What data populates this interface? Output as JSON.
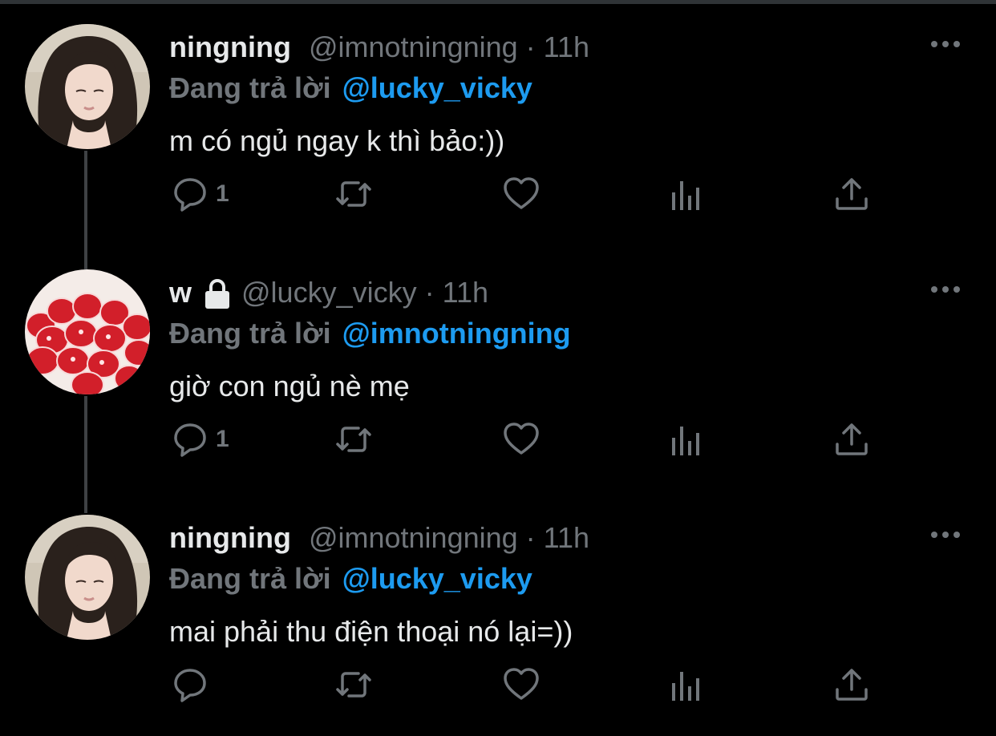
{
  "tweets": [
    {
      "display_name": "ningning",
      "handle": "@imnotningning",
      "separator": "·",
      "time": "11h",
      "reply_prefix": "Đang trả lời",
      "reply_to": "@lucky_vicky",
      "text": "m có ngủ ngay k thì bảo:))",
      "reply_count": "1",
      "locked": false,
      "avatar_icon": "profile-photo-woman"
    },
    {
      "display_name": "w",
      "handle": "@lucky_vicky",
      "separator": "·",
      "time": "11h",
      "reply_prefix": "Đang trả lời",
      "reply_to": "@imnotningning",
      "text": "giờ con ngủ nè mẹ",
      "reply_count": "1",
      "locked": true,
      "avatar_icon": "profile-photo-strawberries"
    },
    {
      "display_name": "ningning",
      "handle": "@imnotningning",
      "separator": "·",
      "time": "11h",
      "reply_prefix": "Đang trả lời",
      "reply_to": "@lucky_vicky",
      "text": "mai phải thu điện thoại nó lại=))",
      "reply_count": "",
      "locked": false,
      "avatar_icon": "profile-photo-woman"
    }
  ],
  "icons": {
    "reply": "reply-bubble-icon",
    "retweet": "retweet-icon",
    "like": "heart-icon",
    "views": "analytics-bars-icon",
    "share": "share-upload-icon",
    "more": "more-dots-icon",
    "lock": "lock-icon"
  },
  "colors": {
    "background": "#000000",
    "text": "#e7e9ea",
    "muted": "#71767b",
    "accent": "#1d9bf0",
    "thread_line": "#3e4144"
  }
}
